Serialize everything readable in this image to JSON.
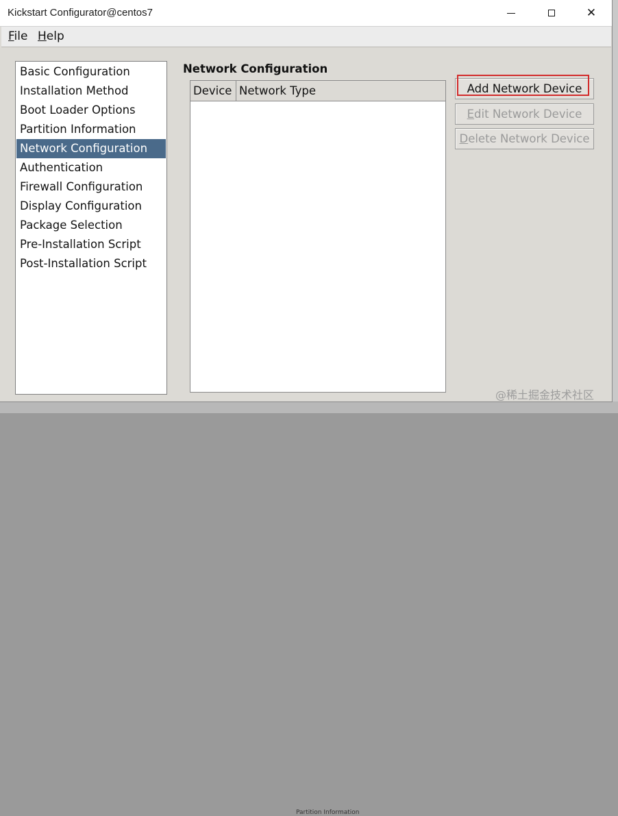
{
  "window": {
    "title": "Kickstart Configurator@centos7",
    "controls": {
      "close_glyph": "✕"
    }
  },
  "menubar": {
    "file": {
      "mnemonic": "F",
      "rest": "ile"
    },
    "help": {
      "mnemonic": "H",
      "rest": "elp"
    }
  },
  "sidebar": {
    "items": [
      {
        "label": "Basic Configuration"
      },
      {
        "label": "Installation Method"
      },
      {
        "label": "Boot Loader Options"
      },
      {
        "label": "Partition Information"
      },
      {
        "label": "Network Configuration",
        "selected": true
      },
      {
        "label": "Authentication"
      },
      {
        "label": "Firewall Configuration"
      },
      {
        "label": "Display Configuration"
      },
      {
        "label": "Package Selection"
      },
      {
        "label": "Pre-Installation Script"
      },
      {
        "label": "Post-Installation Script"
      }
    ]
  },
  "main": {
    "title": "Network Configuration",
    "table": {
      "columns": [
        "Device",
        "Network Type"
      ],
      "rows": []
    },
    "buttons": {
      "add": {
        "label": "Add Network Device",
        "enabled": true
      },
      "edit": {
        "mnemonic": "E",
        "rest": "dit Network Device",
        "enabled": false
      },
      "delete": {
        "mnemonic": "D",
        "rest": "elete Network Device",
        "enabled": false
      }
    }
  },
  "background": {
    "bottom_text": "Partition Information"
  },
  "watermark": "@稀土掘金技术社区",
  "colors": {
    "selection": "#4a6a8a",
    "highlight_box": "#d22a2a",
    "window_bg": "#dcdad5"
  }
}
